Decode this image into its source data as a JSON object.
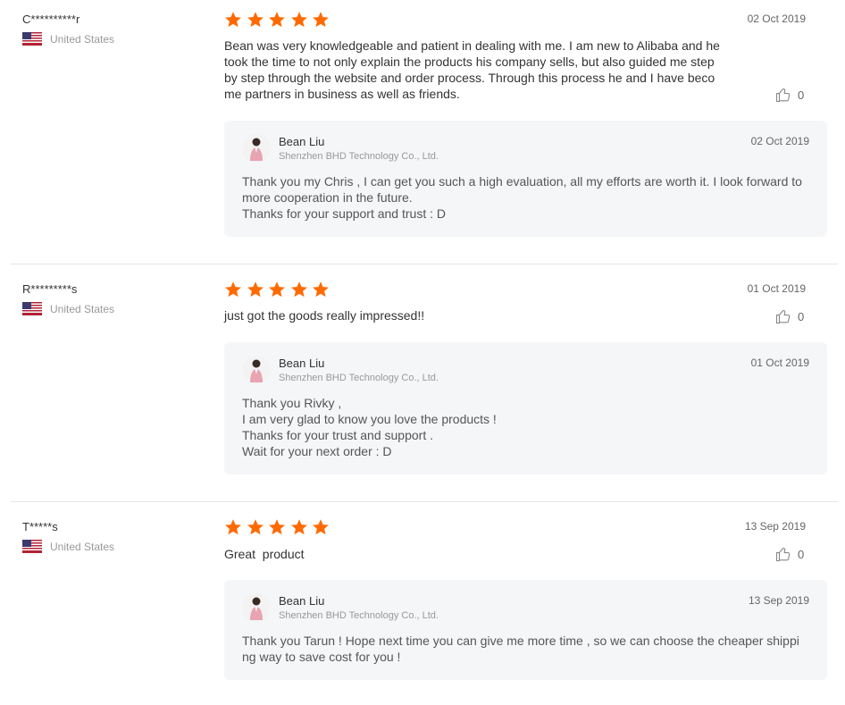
{
  "colors": {
    "star": "#ff6a00",
    "flag_red": "#b22234",
    "flag_blue": "#3c3b6e"
  },
  "icons": {
    "rating": "star-icon",
    "country": "us-flag-icon",
    "like": "thumbs-up-icon"
  },
  "reviews": [
    {
      "buyer": "C**********r",
      "country": "United States",
      "rating": 5,
      "date": "02 Oct 2019",
      "text": "Bean was very knowledgeable and patient in dealing with me. I am new to Alibaba and he took the time to not only explain the products his company sells, but also guided me step by step through the website and order process. Through this process he and I have become partners in business as well as friends.",
      "likes": "0",
      "reply": {
        "seller": "Bean Liu",
        "company": "Shenzhen BHD Technology Co., Ltd.",
        "date": "02 Oct 2019",
        "text": "Thank you my Chris , I can get you such a high evaluation, all my efforts are worth it. I look forward to more cooperation in the future.\nThanks for your support and trust : D"
      }
    },
    {
      "buyer": "R*********s",
      "country": "United States",
      "rating": 5,
      "date": "01 Oct 2019",
      "text": "just got the goods really impressed!!",
      "likes": "0",
      "reply": {
        "seller": "Bean Liu",
        "company": "Shenzhen BHD Technology Co., Ltd.",
        "date": "01 Oct 2019",
        "text": "Thank you Rivky ,\nI am very glad to know you love the products !\nThanks for your trust and support .\nWait for your next order : D"
      }
    },
    {
      "buyer": "T*****s",
      "country": "United States",
      "rating": 5,
      "date": "13 Sep 2019",
      "text": "Great  product",
      "likes": "0",
      "reply": {
        "seller": "Bean Liu",
        "company": "Shenzhen BHD Technology Co., Ltd.",
        "date": "13 Sep 2019",
        "text": "Thank you Tarun ! Hope next time you can give me more time , so we can choose the cheaper shipping way to save cost for you !"
      }
    }
  ]
}
